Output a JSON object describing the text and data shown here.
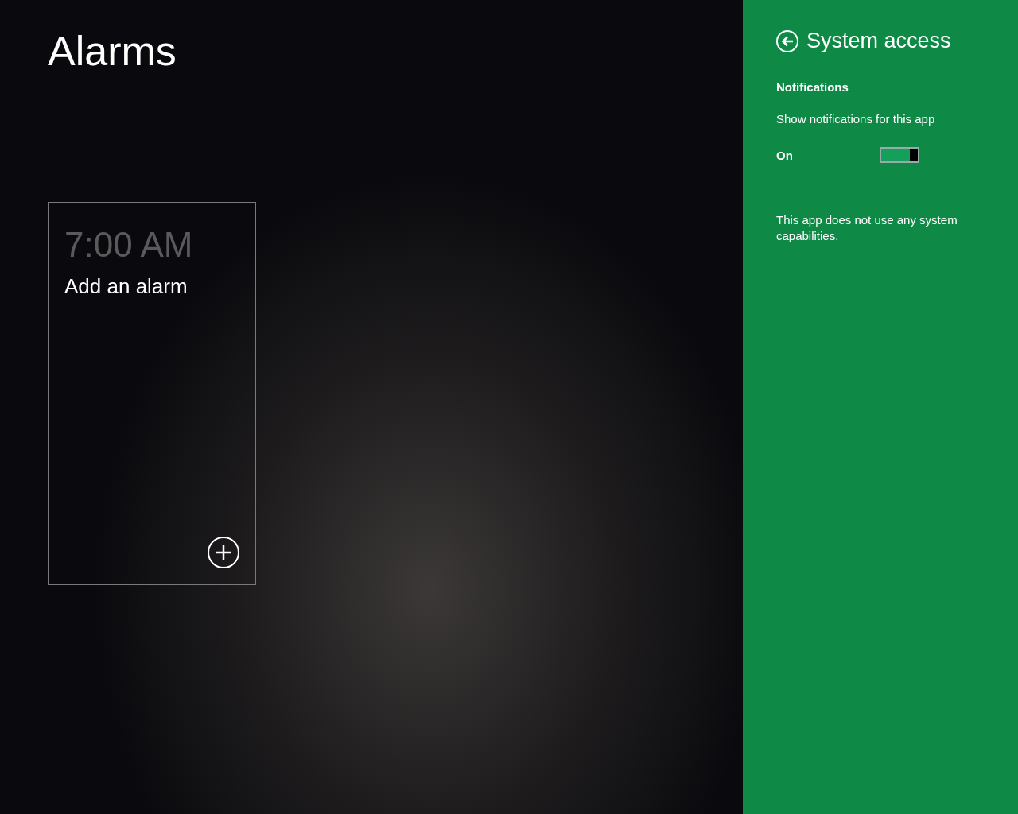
{
  "app": {
    "title": "Alarms"
  },
  "alarm_tile": {
    "time": "7:00 AM",
    "label": "Add an alarm"
  },
  "panel": {
    "title": "System access",
    "section": "Notifications",
    "setting_label": "Show notifications for this app",
    "toggle": {
      "label": "On",
      "on": true
    },
    "note": "This app does not use any system capabilities."
  }
}
